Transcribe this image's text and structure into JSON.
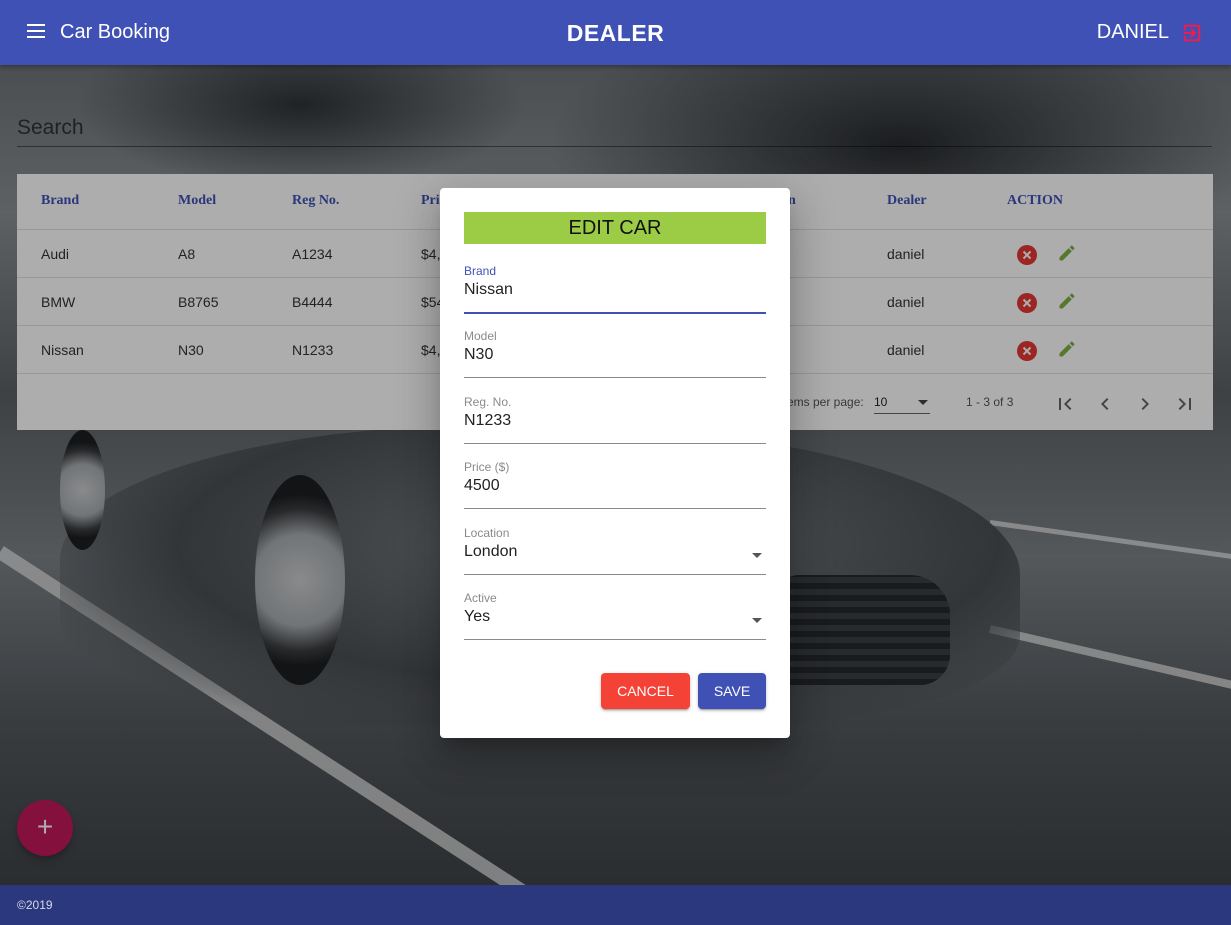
{
  "header": {
    "app_title": "Car Booking",
    "page_title": "DEALER",
    "user_name": "DANIEL"
  },
  "search": {
    "placeholder": "Search"
  },
  "table": {
    "columns": {
      "brand": "Brand",
      "model": "Model",
      "reg": "Reg No.",
      "price_partial": "Pri",
      "location_partial": "n",
      "dealer": "Dealer",
      "action": "ACTION"
    },
    "rows": [
      {
        "brand": "Audi",
        "model": "A8",
        "reg": "A1234",
        "price_partial": "$4,",
        "dealer": "daniel"
      },
      {
        "brand": "BMW",
        "model": "B8765",
        "reg": "B4444",
        "price_partial": "$54",
        "dealer": "daniel"
      },
      {
        "brand": "Nissan",
        "model": "N30",
        "reg": "N1233",
        "price_partial": "$4,",
        "dealer": "daniel"
      }
    ],
    "paginator": {
      "items_label": "ems per page:",
      "page_size": "10",
      "range": "1 - 3 of 3"
    }
  },
  "dialog": {
    "title": "EDIT CAR",
    "fields": {
      "brand": {
        "label": "Brand",
        "value": "Nissan"
      },
      "model": {
        "label": "Model",
        "value": "N30"
      },
      "reg": {
        "label": "Reg. No.",
        "value": "N1233"
      },
      "price": {
        "label": "Price ($)",
        "value": "4500"
      },
      "location": {
        "label": "Location",
        "value": "London"
      },
      "active": {
        "label": "Active",
        "value": "Yes"
      }
    },
    "cancel_label": "CANCEL",
    "save_label": "SAVE"
  },
  "fab": {
    "label": "+"
  },
  "footer": {
    "text": "©2019"
  },
  "colors": {
    "primary": "#3f51b5",
    "accent": "#c2185b",
    "warn": "#f44336",
    "title_bar": "#9ccc45",
    "edit_icon": "#7cb342",
    "footer": "#2c387e"
  }
}
